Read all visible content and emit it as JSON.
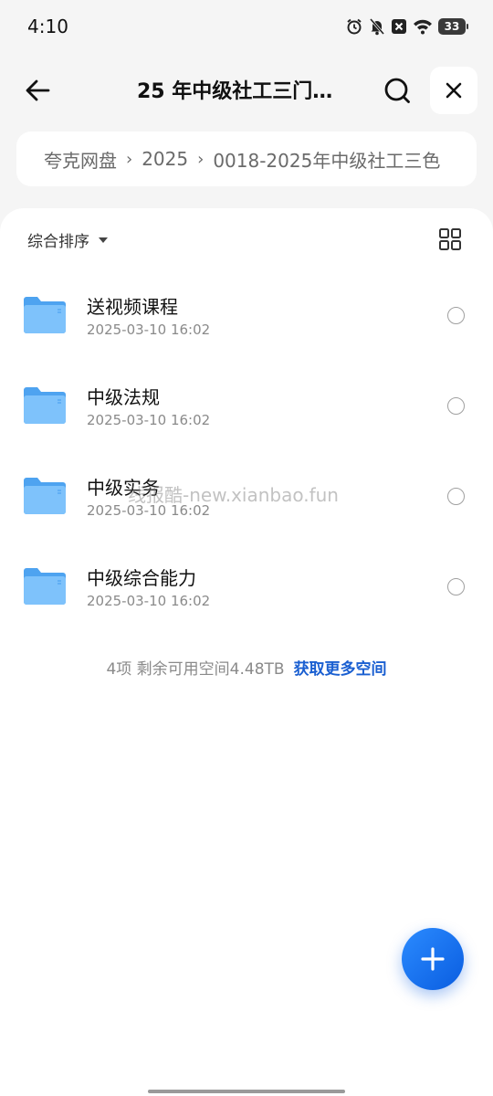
{
  "status_bar": {
    "time": "4:10",
    "battery": "33",
    "icons": [
      "alarm-icon",
      "bell-off-icon",
      "notification-x-icon",
      "wifi-icon",
      "battery-icon"
    ]
  },
  "header": {
    "title": "25 年中级社工三门…",
    "back_icon": "arrow-left-icon",
    "search_icon": "search-icon",
    "close_icon": "close-icon"
  },
  "breadcrumb": {
    "items": [
      "夸克网盘",
      "2025",
      "0018-2025年中级社工三色"
    ],
    "separator": "›"
  },
  "toolbar": {
    "sort_label": "综合排序",
    "view_toggle_icon": "grid-view-icon"
  },
  "files": [
    {
      "name": "送视频课程",
      "date": "2025-03-10 16:02"
    },
    {
      "name": "中级法规",
      "date": "2025-03-10 16:02"
    },
    {
      "name": "中级实务",
      "date": "2025-03-10 16:02"
    },
    {
      "name": "中级综合能力",
      "date": "2025-03-10 16:02"
    }
  ],
  "footer": {
    "count_text": "4项 剩余可用空间4.48TB",
    "link_text": "获取更多空间"
  },
  "watermark": "线报酷-new.xianbao.fun",
  "fab": {
    "icon": "plus-icon"
  },
  "colors": {
    "accent": "#1a5fd1",
    "fab": "#0a5de0",
    "folder": "#5aaef5",
    "background": "#f5f5f5"
  }
}
